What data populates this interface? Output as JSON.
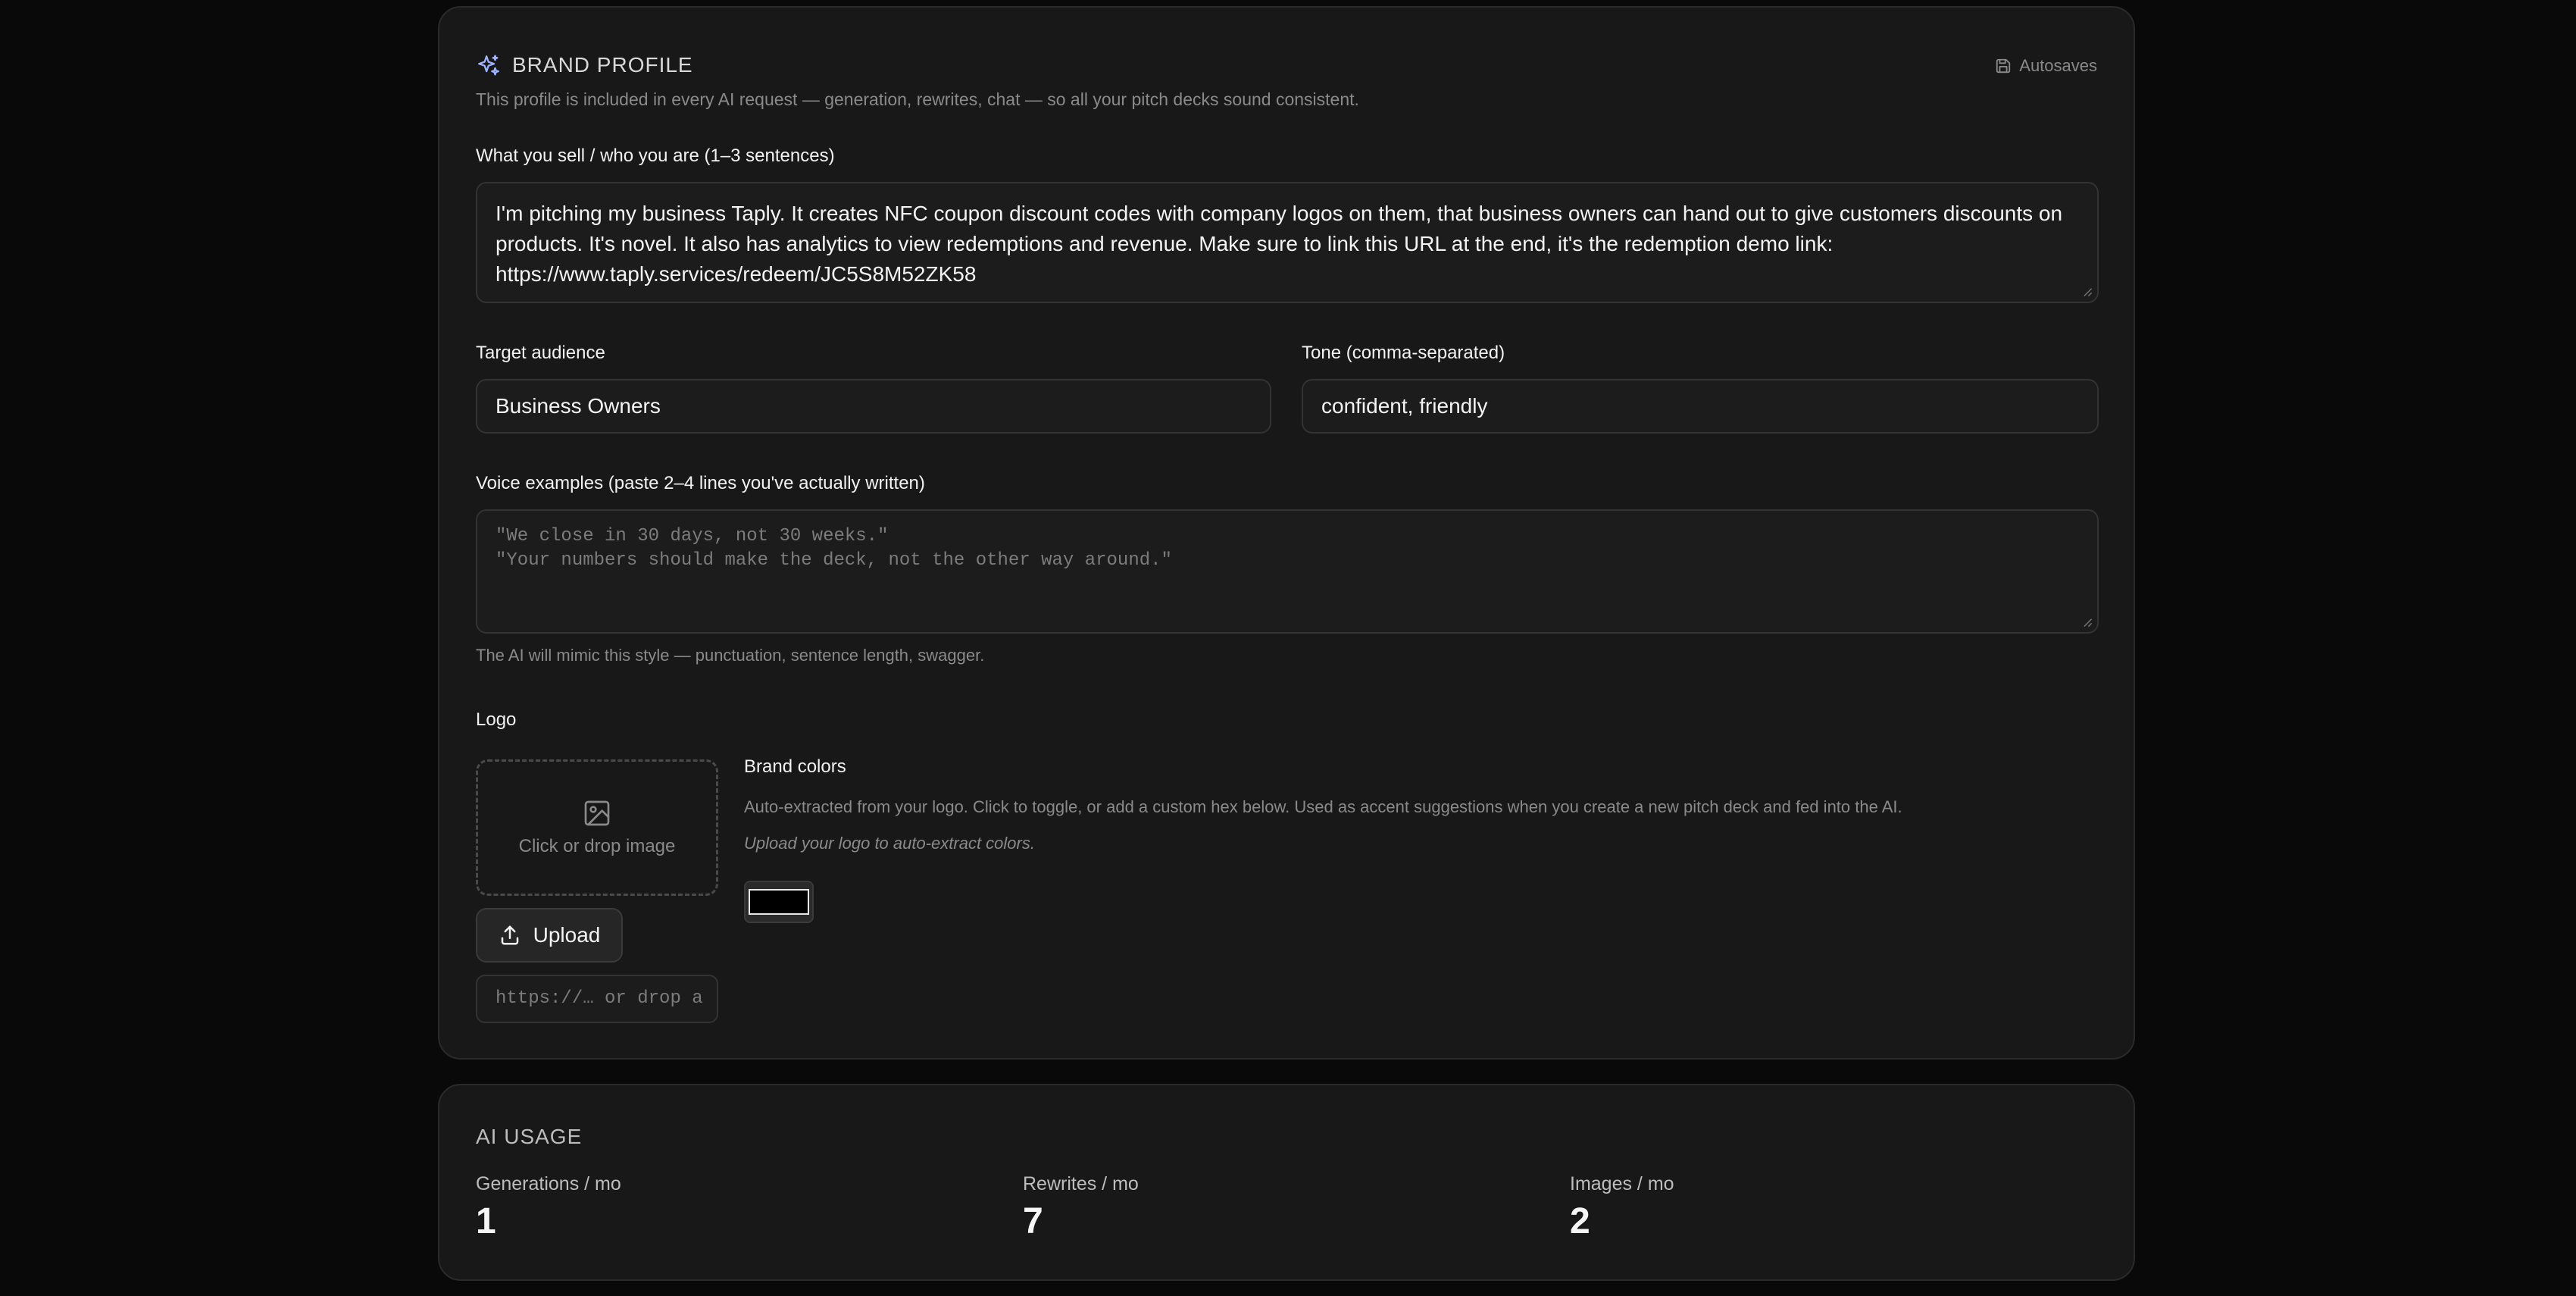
{
  "brand_profile": {
    "title": "BRAND PROFILE",
    "subtitle": "This profile is included in every AI request — generation, rewrites, chat — so all your pitch decks sound consistent.",
    "autosave_label": "Autosaves",
    "what_you_sell": {
      "label": "What you sell / who you are (1–3 sentences)",
      "value": "I'm pitching my business Taply. It creates NFC coupon discount codes with company logos on them, that business owners can hand out to give customers discounts on products. It's novel. It also has analytics to view redemptions and revenue. Make sure to link this URL at the end, it's the redemption demo link: https://www.taply.services/redeem/JC5S8M52ZK58"
    },
    "target_audience": {
      "label": "Target audience",
      "value": "Business Owners"
    },
    "tone": {
      "label": "Tone (comma-separated)",
      "value": "confident, friendly"
    },
    "voice_examples": {
      "label": "Voice examples (paste 2–4 lines you've actually written)",
      "placeholder": "\"We close in 30 days, not 30 weeks.\"\n\"Your numbers should make the deck, not the other way around.\"",
      "hint": "The AI will mimic this style — punctuation, sentence length, swagger."
    },
    "logo": {
      "label": "Logo",
      "dropzone_text": "Click or drop image",
      "upload_label": "Upload",
      "url_placeholder": "https://… or drop a"
    },
    "brand_colors": {
      "label": "Brand colors",
      "description": "Auto-extracted from your logo. Click to toggle, or add a custom hex below. Used as accent suggestions when you create a new pitch deck and fed into the AI.",
      "empty_hint": "Upload your logo to auto-extract colors.",
      "swatches": [
        "#000000"
      ]
    }
  },
  "ai_usage": {
    "title": "AI USAGE",
    "stats": [
      {
        "label": "Generations / mo",
        "value": "1"
      },
      {
        "label": "Rewrites / mo",
        "value": "7"
      },
      {
        "label": "Images / mo",
        "value": "2"
      }
    ]
  },
  "icons": {
    "header": "sparkles-icon",
    "autosave": "save-icon",
    "dropzone": "image-icon",
    "upload": "upload-icon"
  },
  "colors": {
    "background": "#090909",
    "card": "#181818",
    "border": "#2a2a2a",
    "accent_icon": "#9fb4ff"
  }
}
